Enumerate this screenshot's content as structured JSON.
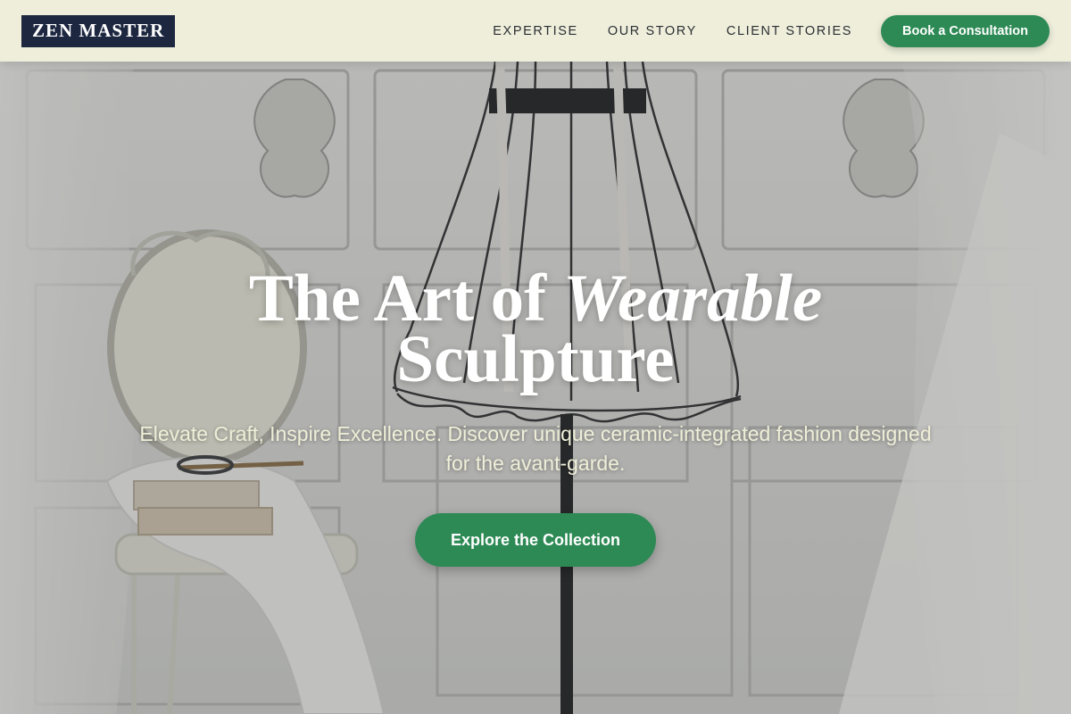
{
  "brand": {
    "logo_text": "ZEN MASTER"
  },
  "nav": {
    "items": [
      {
        "label": "EXPERTISE"
      },
      {
        "label": "OUR STORY"
      },
      {
        "label": "CLIENT STORIES"
      }
    ],
    "cta_label": "Book a Consultation"
  },
  "hero": {
    "headline_part1": "The Art of ",
    "headline_italic": "Wearable",
    "headline_line2": "Sculpture",
    "subtitle": "Elevate Craft, Inspire Excellence. Discover unique ceramic-integrated fashion designed for the avant-garde.",
    "button_label": "Explore the Collection"
  },
  "colors": {
    "header_bg": "#eeeedb",
    "logo_bg": "#1d2740",
    "accent_green": "#2d8a55",
    "nav_text": "#2b2f33"
  }
}
